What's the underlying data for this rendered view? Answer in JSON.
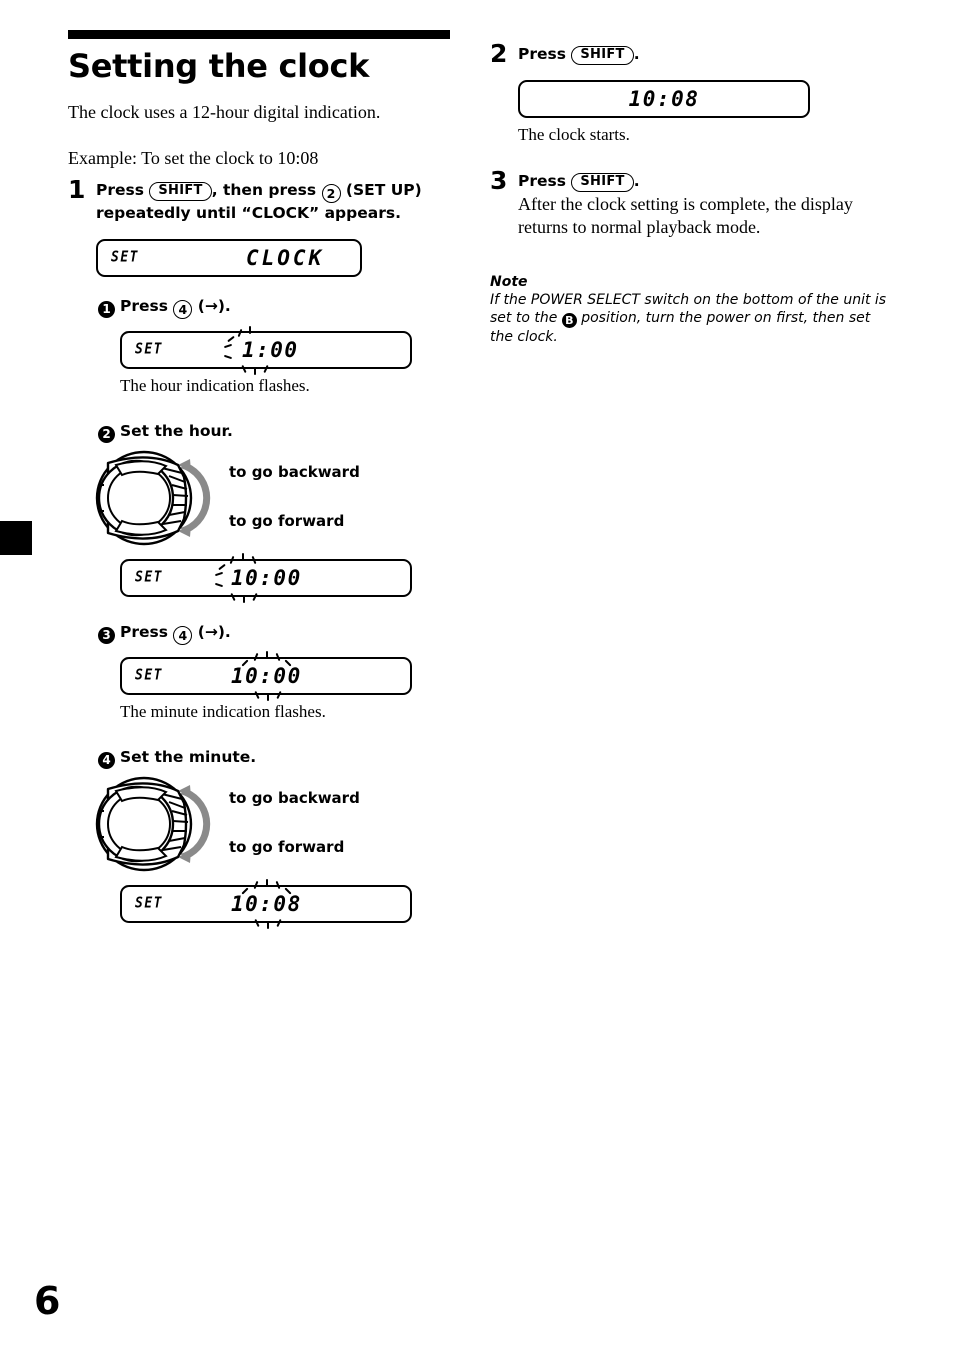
{
  "page": {
    "number": "6",
    "edge_tab": "black-section-tab"
  },
  "heading": {
    "title": "Setting the clock",
    "intro": "The clock uses a 12-hour digital indication.",
    "example": "Example: To set the clock to 10:08"
  },
  "steps": {
    "step1": {
      "number": "1",
      "press_label": "Press",
      "key_shift": "SHIFT",
      "then_press": ", then press",
      "key_2": "2",
      "set_up": "(SET UP)",
      "line2": "repeatedly until “CLOCK” appears."
    },
    "step2": {
      "number": "2",
      "press_label": "Press",
      "key_shift": "SHIFT",
      "period": ".",
      "caption": "The clock starts."
    },
    "step3": {
      "number": "3",
      "press_label": "Press",
      "key_shift": "SHIFT",
      "period": ".",
      "body": "After the clock setting is complete, the display returns to normal playback mode."
    }
  },
  "substeps": {
    "s1": {
      "bullet": "1",
      "press_label": "Press",
      "key_4": "4",
      "arrow": "(→).",
      "caption": "The hour indication flashes."
    },
    "s2": {
      "bullet": "2",
      "label": "Set the hour."
    },
    "s3": {
      "bullet": "3",
      "press_label": "Press",
      "key_4": "4",
      "arrow": "(→).",
      "caption": "The minute indication flashes."
    },
    "s4": {
      "bullet": "4",
      "label": "Set the minute."
    }
  },
  "knob": {
    "backward": "to go backward",
    "forward": "to go forward"
  },
  "displays": {
    "clock_word": {
      "set": "SET",
      "value": "CLOCK",
      "flashing": "none"
    },
    "hour_1_00": {
      "set": "SET",
      "value": "1:00",
      "flashing": "hour"
    },
    "hour_10_00": {
      "set": "SET",
      "value": "10:00",
      "flashing": "hour"
    },
    "minute_10_00": {
      "set": "SET",
      "value": "10:00",
      "flashing": "minute"
    },
    "minute_10_08": {
      "set": "SET",
      "value": "10:08",
      "flashing": "minute"
    },
    "final_10_08": {
      "set": "",
      "value": "10:08",
      "flashing": "none"
    }
  },
  "note": {
    "title": "Note",
    "part1": "If the POWER SELECT switch on the bottom of the unit is set to the",
    "badge": "B",
    "part2": "position, turn the power on first, then set the clock."
  },
  "colors": {
    "ink": "#000000",
    "paper": "#ffffff",
    "knob_arrow": "#8a8a8a"
  }
}
